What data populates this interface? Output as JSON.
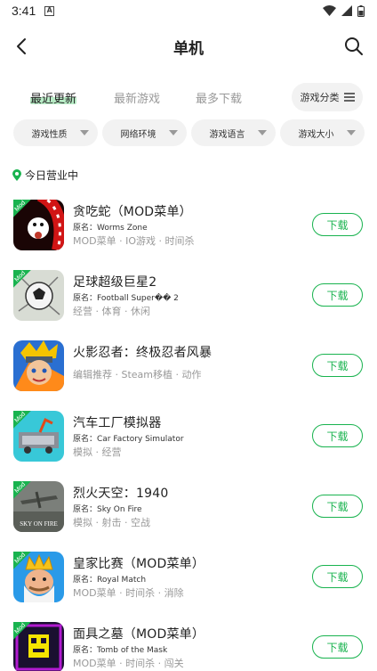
{
  "status": {
    "time": "3:41"
  },
  "header": {
    "title": "单机"
  },
  "tabs": [
    {
      "label": "最近更新",
      "active": true
    },
    {
      "label": "最新游戏",
      "active": false
    },
    {
      "label": "最多下载",
      "active": false
    }
  ],
  "category_button": {
    "label": "游戏分类"
  },
  "filters": [
    {
      "label": "游戏性质"
    },
    {
      "label": "网络环境"
    },
    {
      "label": "游戏语言"
    },
    {
      "label": "游戏大小"
    }
  ],
  "section": {
    "title": "今日营业中"
  },
  "download_label": "下载",
  "mod_badge_label": "Mod",
  "games": [
    {
      "name": "贪吃蛇（MOD菜单）",
      "original": "原名：Worms Zone",
      "tags": "MOD菜单 · IO游戏 · 时间杀",
      "mod": true,
      "icon": "worms-zone-icon"
    },
    {
      "name": "足球超级巨星2",
      "original": "原名：Football Super�� 2",
      "tags": "经营 · 体育 · 休闲",
      "mod": true,
      "icon": "football-superstar-icon"
    },
    {
      "name": "火影忍者：终极忍者风暴",
      "original": "",
      "tags": "编辑推荐 · Steam移植 · 动作",
      "mod": false,
      "icon": "naruto-icon"
    },
    {
      "name": "汽车工厂模拟器",
      "original": "原名：Car Factory Simulator",
      "tags": "模拟 · 经营",
      "mod": true,
      "icon": "car-factory-icon"
    },
    {
      "name": "烈火天空：1940",
      "original": "原名：Sky On Fire",
      "tags": "模拟 · 射击 · 空战",
      "mod": true,
      "icon": "sky-on-fire-icon"
    },
    {
      "name": "皇家比赛（MOD菜单）",
      "original": "原名：Royal Match",
      "tags": "MOD菜单 · 时间杀 · 消除",
      "mod": true,
      "icon": "royal-match-icon"
    },
    {
      "name": "面具之墓（MOD菜单）",
      "original": "原名：Tomb of the Mask",
      "tags": "MOD菜单 · 时间杀 · 闯关",
      "mod": true,
      "icon": "tomb-of-the-mask-icon"
    }
  ],
  "colors": {
    "accent": "#19b34f",
    "tab_highlight": "#b8ecc6",
    "chip_bg": "#f2f2f2"
  }
}
